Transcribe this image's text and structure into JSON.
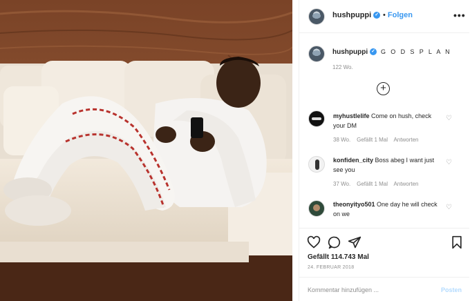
{
  "header": {
    "username": "hushpuppi",
    "verified_mark": "✓",
    "separator": "•",
    "follow_label": "Folgen",
    "more_label": "•••"
  },
  "caption": {
    "username": "hushpuppi",
    "text": "G O D S P L A N",
    "age": "122 Wo."
  },
  "load_more_label": "+",
  "comments": [
    {
      "username": "myhustlelife",
      "text": "Come on hush, check your DM",
      "age": "38 Wo.",
      "likes": "Gefällt 1 Mal",
      "reply_label": "Antworten"
    },
    {
      "username": "konfiden_city",
      "text": "Boss abeg I want just see you",
      "age": "37 Wo.",
      "likes": "Gefällt 1 Mal",
      "reply_label": "Antworten"
    },
    {
      "username": "theonyityo501",
      "text": "One day he will check on we"
    }
  ],
  "post": {
    "likes": "Gefällt 114.743 Mal",
    "date": "24. FEBRUAR 2018"
  },
  "comment_input": {
    "placeholder": "Kommentar hinzufügen ...",
    "post_label": "Posten"
  },
  "icons": {
    "heart": "heart-icon",
    "comment": "comment-icon",
    "share": "share-icon",
    "bookmark": "bookmark-icon"
  },
  "colors": {
    "link_blue": "#3897f0",
    "text": "#262626",
    "muted": "#8e8e8e",
    "post_disabled": "#b3dbff"
  }
}
